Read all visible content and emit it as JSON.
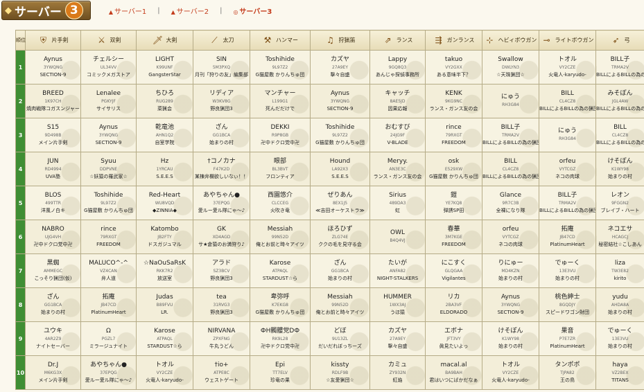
{
  "header": {
    "logo": "サーバー",
    "logo_num": "3",
    "tabs": [
      {
        "label": "サーバー1",
        "mark": "▲"
      },
      {
        "label": "サーバー2",
        "mark": "▲"
      },
      {
        "label": "サーバー3",
        "mark": "◎"
      }
    ],
    "separator": "|"
  },
  "table": {
    "rank_header": "順位",
    "weapons": [
      "片手剣",
      "双剣",
      "大剣",
      "太刀",
      "ハンマー",
      "狩猟笛",
      "ランス",
      "ガンランス",
      "ヘビィボウガン",
      "ライトボウガン",
      "弓"
    ],
    "rows": [
      {
        "rank": "1",
        "cells": [
          {
            "name": "Aynus",
            "id": "3YWQNG",
            "guild": "SECTION-9"
          },
          {
            "name": "チェルシー",
            "id": "UL34VV",
            "guild": "コミックメガストア"
          },
          {
            "name": "LIGHT",
            "id": "K99UNF",
            "guild": "GangsterStar"
          },
          {
            "name": "SIN",
            "id": "5M3PXQ",
            "guild": "月刊「狩りの友」編集部"
          },
          {
            "name": "Toshihide",
            "id": "9L97Z2",
            "guild": "G猫屋敷 かりんちゅ団"
          },
          {
            "name": "カズヤ",
            "id": "27A9EY",
            "guild": "撃々自盛"
          },
          {
            "name": "Lappy",
            "id": "9GQ8Q3",
            "guild": "あんじゃ探偵事務所"
          },
          {
            "name": "takuo",
            "id": "VY2GXX",
            "guild": "ある意味半下？"
          },
          {
            "name": "Swallow",
            "id": "DWLYN3",
            "guild": "☆天珠猟団☆"
          },
          {
            "name": "トオル",
            "id": "VY2CZE",
            "guild": "火竜人-karyudo-"
          },
          {
            "name": "BILL子",
            "id": "TRMA2V",
            "guild": "BILLによるBILLの為の猟団"
          }
        ]
      },
      {
        "rank": "2",
        "cells": [
          {
            "name": "BREED",
            "id": "1K97CH",
            "guild": "焼肉戦隊コガスンジャー"
          },
          {
            "name": "Lenalee",
            "id": "PGKYJF",
            "guild": "サイサリス"
          },
          {
            "name": "ちひろ",
            "id": "RUG289",
            "guild": "菜猟会"
          },
          {
            "name": "リディア",
            "id": "W3KV8G",
            "guild": "野良猟団3"
          },
          {
            "name": "マンチャー",
            "id": "L199G1",
            "guild": "死んだだけで"
          },
          {
            "name": "Aynus",
            "id": "3YWQNG",
            "guild": "SECTION-9"
          },
          {
            "name": "キャッチ",
            "id": "8AE5JD",
            "guild": "因果応報"
          },
          {
            "name": "KENK",
            "id": "9KG9NC",
            "guild": "ランス・ガンス友の会"
          },
          {
            "name": "にゅう",
            "id": "RH3G84",
            "guild": ""
          },
          {
            "name": "BILL",
            "id": "CL4CZ8",
            "guild": "BILLによるBILLの為の猟団"
          },
          {
            "name": "みそぽん",
            "id": "JGL4AW",
            "guild": "BILLによるBILLの為の猟団"
          }
        ]
      },
      {
        "rank": "3",
        "cells": [
          {
            "name": "S15",
            "id": "9D498B",
            "guild": "メイン片手剣"
          },
          {
            "name": "Aynus",
            "id": "3YWQNG",
            "guild": "SECTION-9"
          },
          {
            "name": "乾竜池",
            "id": "AHN1Q2",
            "guild": "自室学院"
          },
          {
            "name": "ざん",
            "id": "GG1BCA",
            "guild": "始まりの村"
          },
          {
            "name": "DEKKI",
            "id": "R9P8GB",
            "guild": "卍中ドクロ党中卍"
          },
          {
            "name": "Toshihide",
            "id": "9L97Z2",
            "guild": "G猫屋敷 かりんちゅ団"
          },
          {
            "name": "おむすび",
            "id": "24JG9F",
            "guild": "V-BLADE"
          },
          {
            "name": "rince",
            "id": "79RXGT",
            "guild": "FREEDOM"
          },
          {
            "name": "BILL子",
            "id": "TRMA2V",
            "guild": "BILLによるBILLの為の猟団"
          },
          {
            "name": "にゅう",
            "id": "RH3G84",
            "guild": ""
          },
          {
            "name": "BILL",
            "id": "CL4CZ8",
            "guild": "BILLによるBILLの為の猟団"
          }
        ]
      },
      {
        "rank": "4",
        "cells": [
          {
            "name": "JUN",
            "id": "RD4994",
            "guild": "UVA塾"
          },
          {
            "name": "Syuu",
            "id": "DDPVNE",
            "guild": "☆妖猿の羅武家☆"
          },
          {
            "name": "Hz",
            "id": "1YRCAU",
            "guild": "S.E.E.S"
          },
          {
            "name": "†コノカナ",
            "id": "F47K2D",
            "guild": "某棟弁欄欲しいなぃ！！"
          },
          {
            "name": "眼部",
            "id": "BL3BVT",
            "guild": "フロンティア"
          },
          {
            "name": "Hound",
            "id": "LA92X3",
            "guild": "S.E.E.S"
          },
          {
            "name": "Meryy.",
            "id": "AN3E3C",
            "guild": "ランス・ガンス友の会"
          },
          {
            "name": "osk",
            "id": "E529XW",
            "guild": "G猫屋敷 かりんちゅ団"
          },
          {
            "name": "BILL",
            "id": "CL4CZ8",
            "guild": "BILLによるBILLの為の猟団"
          },
          {
            "name": "orfeu",
            "id": "VYTCGZ",
            "guild": "ネコの肉球"
          },
          {
            "name": "けそぽん",
            "id": "K1WY98",
            "guild": "始まりの村"
          }
        ]
      },
      {
        "rank": "5",
        "cells": [
          {
            "name": "BLOS",
            "id": "499TTR",
            "guild": "洋風ノ白キ"
          },
          {
            "name": "Toshihide",
            "id": "9L97Z2",
            "guild": "G猫屋敷 かりんちゅ団"
          },
          {
            "name": "Red-Heart",
            "id": "WU8VQD",
            "guild": "◆ZINNIA◆"
          },
          {
            "name": "あやちゃん●",
            "id": "37EPQG",
            "guild": "愛ルー愛ル隊にゃ～♪"
          },
          {
            "name": "西園悠介",
            "id": "CLCCEG",
            "guild": "火吹き竜"
          },
          {
            "name": "ぜりあん",
            "id": "8EX1J5",
            "guild": "≪吉田オーケストラ≫"
          },
          {
            "name": "Sirius",
            "id": "489DA3",
            "guild": "虹"
          },
          {
            "name": "鎧",
            "id": "YE7KQ8",
            "guild": "弾誘SP田"
          },
          {
            "name": "Glance",
            "id": "9R7C3B",
            "guild": "全裸になり隊"
          },
          {
            "name": "BILL子",
            "id": "TRMA2V",
            "guild": "BILLによるBILLの為の猟団"
          },
          {
            "name": "レオン",
            "id": "9FGGN2",
            "guild": "ブレイブ・ハート"
          }
        ]
      },
      {
        "rank": "6",
        "cells": [
          {
            "name": "NABRO",
            "id": "UJG4VH",
            "guild": "卍中ドクロ党中卍"
          },
          {
            "name": "rince",
            "id": "79RXGT",
            "guild": "FREEDOM"
          },
          {
            "name": "Katombo",
            "id": "JB2FTY",
            "guild": "ドスガジュマル"
          },
          {
            "name": "GK",
            "id": "XD4AGD",
            "guild": "サ★倉猿のお満狩り♪"
          },
          {
            "name": "Messiah",
            "id": "99N52D",
            "guild": "俺とお前と時々アイツ"
          },
          {
            "name": "ほろひず",
            "id": "ZLG74E",
            "guild": "ククの毛を見守る会"
          },
          {
            "name": "OWL",
            "id": "B4Q4VJ",
            "guild": ""
          },
          {
            "name": "春華",
            "id": "3M7KGE",
            "guild": "FREEDOM"
          },
          {
            "name": "orfeu",
            "id": "VYTCGZ",
            "guild": "ネコの肉球"
          },
          {
            "name": "拓庵",
            "id": "JB47CD",
            "guild": "PlatinumHeart"
          },
          {
            "name": "ネコエサ",
            "id": "HCAGCJ",
            "guild": "秘密結社☆こしあん"
          }
        ]
      },
      {
        "rank": "7",
        "cells": [
          {
            "name": "黒蜘",
            "id": "AMMEGC",
            "guild": "こっそり猟団(仮)"
          },
          {
            "name": "MALUCO^-^",
            "id": "VZ4CAN",
            "guild": "弁人道"
          },
          {
            "name": "☆NaOuSaRsK",
            "id": "RKK7R2",
            "guild": "放送室"
          },
          {
            "name": "アラド",
            "id": "SZ3BCV",
            "guild": "野良猟団3"
          },
          {
            "name": "Karose",
            "id": "ATPAQL",
            "guild": "STARDUST☆ら"
          },
          {
            "name": "ざん",
            "id": "GG1BCA",
            "guild": "始まりの村"
          },
          {
            "name": "たいが",
            "id": "ANFA82",
            "guild": "NIGHT-STALKERS"
          },
          {
            "name": "にこすく",
            "id": "GLQGAA",
            "guild": "Vigilantes"
          },
          {
            "name": "りにゅー",
            "id": "MD4KZN",
            "guild": "始まりの村"
          },
          {
            "name": "でゅーく",
            "id": "13E3VU",
            "guild": "始まりの村"
          },
          {
            "name": "liza",
            "id": "TW3E82",
            "guild": "kirito"
          }
        ]
      },
      {
        "rank": "8",
        "cells": [
          {
            "name": "ざん",
            "id": "GG1BCA",
            "guild": "始まりの村"
          },
          {
            "name": "拓庵",
            "id": "JB47CD",
            "guild": "PlatinumHeart"
          },
          {
            "name": "Judas",
            "id": "B89FVU",
            "guild": "LR."
          },
          {
            "name": "tea",
            "id": "31RVG3",
            "guild": "野良猟団3"
          },
          {
            "name": "卑弥呼",
            "id": "K7EKG8",
            "guild": "G猫屋敷 かりんちゅ団"
          },
          {
            "name": "Messiah",
            "id": "99N52D",
            "guild": "俺とお前と時々アイツ"
          },
          {
            "name": "HUMMER",
            "id": "1WX3AJ",
            "guild": "うほ猿"
          },
          {
            "name": "リカ",
            "id": "2BA3VF",
            "guild": "ELDORADO"
          },
          {
            "name": "Aynus",
            "id": "3YWQNG",
            "guild": "SECTION-9"
          },
          {
            "name": "桃色紳士",
            "id": "8GQDJY",
            "guild": "スピードワゴン財団"
          },
          {
            "name": "yudu",
            "id": "AHDA8A",
            "guild": "始まりの村"
          }
        ]
      },
      {
        "rank": "9",
        "cells": [
          {
            "name": "ユウキ",
            "id": "4AR2Z9",
            "guild": "ナイトセーバー"
          },
          {
            "name": "Ω",
            "id": "PGZL7",
            "guild": "ミラージュナイト"
          },
          {
            "name": "Karose",
            "id": "ATPAQL",
            "guild": "STARDUST☆ら"
          },
          {
            "name": "NIRVANA",
            "id": "ZPXFNG",
            "guild": "牛丸うどん"
          },
          {
            "name": "ФH髑髏党DФ",
            "id": "RK9L28",
            "guild": "卍中ドクロ党中卍"
          },
          {
            "name": "どぼ",
            "id": "9U13ZL",
            "guild": "だいだれぼっちーズ"
          },
          {
            "name": "カズヤ",
            "id": "27A9EY",
            "guild": "撃々自盛"
          },
          {
            "name": "エボナ",
            "id": "JFT3VY",
            "guild": "眞見たいよっ"
          },
          {
            "name": "けそぽん",
            "id": "K1WY98",
            "guild": "始まりの村"
          },
          {
            "name": "果音",
            "id": "P7E7ZR",
            "guild": "PlatinumHeart"
          },
          {
            "name": "でゅーく",
            "id": "13E3VU",
            "guild": "始まりの村"
          }
        ]
      },
      {
        "rank": "10",
        "cells": [
          {
            "name": "Dr.J",
            "id": "M6KG3X",
            "guild": "メイン片手剣"
          },
          {
            "name": "あやちゃん●",
            "id": "37EPQG",
            "guild": "愛ルー愛ル隊にゃ～♪"
          },
          {
            "name": "トオル",
            "id": "VY2CZE",
            "guild": "火竜人-karyudo-"
          },
          {
            "name": "†io+",
            "id": "ATPE8C",
            "guild": "ウェストゲート"
          },
          {
            "name": "Epi",
            "id": "TT7ELV",
            "guild": "珍竜の果"
          },
          {
            "name": "kissty",
            "id": "RDLF9B",
            "guild": "☆友愛猟団☆"
          },
          {
            "name": "カミュ",
            "id": "ZY932N",
            "guild": "紅焔"
          },
          {
            "name": "macal.al",
            "id": "BA9BAH",
            "guild": "君はいつにばかだなぁ"
          },
          {
            "name": "トオル",
            "id": "VY2CZE",
            "guild": "火竜人-karyudo-"
          },
          {
            "name": "タンポポ",
            "id": "TJPA82",
            "guild": "王の鳥"
          },
          {
            "name": "haya",
            "id": "VZ2BEX",
            "guild": "TITANS"
          }
        ]
      }
    ]
  }
}
